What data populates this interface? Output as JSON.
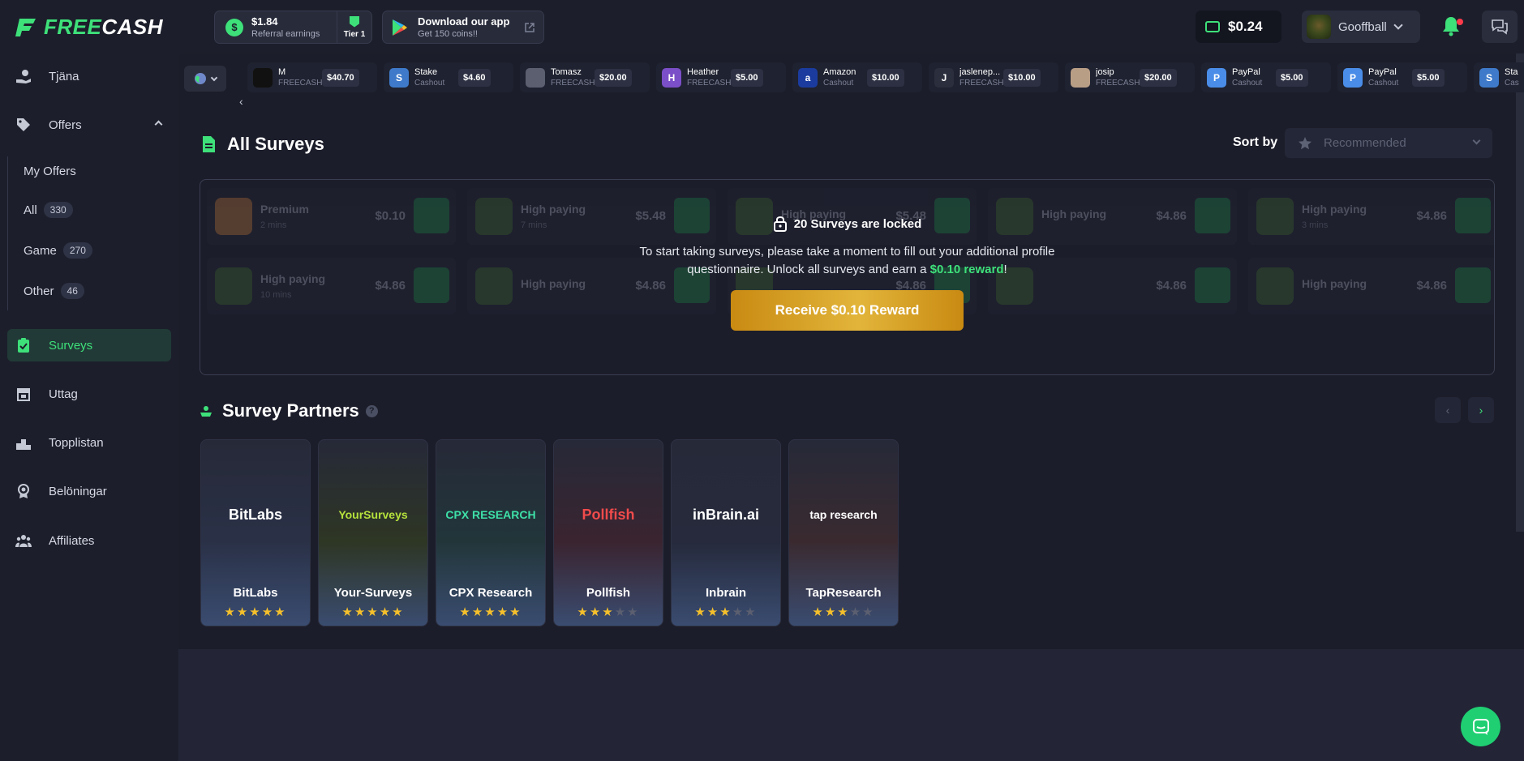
{
  "header": {
    "logo_text_1": "FREE",
    "logo_text_2": "CASH",
    "referral": {
      "amount": "$1.84",
      "label": "Referral earnings",
      "tier": "Tier 1"
    },
    "app_promo": {
      "title": "Download our app",
      "subtitle": "Get 150 coins!!"
    },
    "balance": "$0.24",
    "username": "Gooffball"
  },
  "sidebar": {
    "items": [
      {
        "label": "Tjäna"
      },
      {
        "label": "Offers"
      },
      {
        "label": "Surveys"
      },
      {
        "label": "Uttag"
      },
      {
        "label": "Topplistan"
      },
      {
        "label": "Belöningar"
      },
      {
        "label": "Affiliates"
      }
    ],
    "offers_sub": [
      {
        "label": "My Offers"
      },
      {
        "label": "All",
        "count": "330"
      },
      {
        "label": "Game",
        "count": "270"
      },
      {
        "label": "Other",
        "count": "46"
      }
    ]
  },
  "ticker": [
    {
      "name": "M",
      "source": "FREECASH",
      "amount": "$40.70",
      "color": "#111111",
      "glyph": ""
    },
    {
      "name": "Stake",
      "source": "Cashout",
      "amount": "$4.60",
      "color": "#3e7ac9",
      "glyph": "S"
    },
    {
      "name": "Tomasz",
      "source": "FREECASH",
      "amount": "$20.00",
      "color": "#5b5f70",
      "glyph": ""
    },
    {
      "name": "Heather",
      "source": "FREECASH",
      "amount": "$5.00",
      "color": "#7b4fc7",
      "glyph": "H"
    },
    {
      "name": "Amazon",
      "source": "Cashout",
      "amount": "$10.00",
      "color": "#1b3c9e",
      "glyph": "a"
    },
    {
      "name": "jaslenep...",
      "source": "FREECASH",
      "amount": "$10.00",
      "color": "#2b2f3d",
      "glyph": "J"
    },
    {
      "name": "josip",
      "source": "FREECASH",
      "amount": "$20.00",
      "color": "#b99e86",
      "glyph": ""
    },
    {
      "name": "PayPal",
      "source": "Cashout",
      "amount": "$5.00",
      "color": "#4a8de8",
      "glyph": "P"
    },
    {
      "name": "PayPal",
      "source": "Cashout",
      "amount": "$5.00",
      "color": "#4a8de8",
      "glyph": "P"
    },
    {
      "name": "Sta",
      "source": "Cas",
      "amount": "",
      "color": "#3e7ac9",
      "glyph": "S"
    }
  ],
  "surveys": {
    "title": "All Surveys",
    "sort_label": "Sort by",
    "sort_value": "Recommended",
    "grid": [
      {
        "name": "Premium",
        "time": "2 mins",
        "amount": "$0.10",
        "premium": true
      },
      {
        "name": "High paying",
        "time": "7 mins",
        "amount": "$5.48"
      },
      {
        "name": "High paying",
        "time": "",
        "amount": "$5.48"
      },
      {
        "name": "High paying",
        "time": "",
        "amount": "$4.86"
      },
      {
        "name": "High paying",
        "time": "3 mins",
        "amount": "$4.86"
      },
      {
        "name": "High paying",
        "time": "10 mins",
        "amount": "$4.86"
      },
      {
        "name": "High paying",
        "time": "",
        "amount": "$4.86"
      },
      {
        "name": "",
        "time": "",
        "amount": "$4.86"
      },
      {
        "name": "",
        "time": "",
        "amount": "$4.86"
      },
      {
        "name": "High paying",
        "time": "",
        "amount": "$4.86"
      }
    ],
    "locked_title": "20 Surveys are locked",
    "locked_msg_1": "To start taking surveys, please take a moment to fill out your additional profile questionnaire. Unlock all surveys and earn a ",
    "locked_msg_highlight": "$0.10 reward",
    "locked_msg_2": "!",
    "reward_button": "Receive $0.10 Reward"
  },
  "partners": {
    "title": "Survey Partners",
    "help": "?",
    "list": [
      {
        "name": "BitLabs",
        "logo": "BitLabs",
        "stars": 5,
        "bg": "#2a3147",
        "logo_color": "#ffffff"
      },
      {
        "name": "Your-Surveys",
        "logo": "YourSurveys",
        "stars": 5,
        "bg": "#2e3624",
        "logo_color": "#b6e23c"
      },
      {
        "name": "CPX Research",
        "logo": "CPX RESEARCH",
        "stars": 5,
        "bg": "#22363a",
        "logo_color": "#3ee0a8"
      },
      {
        "name": "Pollfish",
        "logo": "Pollfish",
        "stars": 3,
        "bg": "#3a2430",
        "logo_color": "#f04b4b"
      },
      {
        "name": "Inbrain",
        "logo": "inBrain.ai",
        "stars": 3,
        "bg": "#262a3c",
        "logo_color": "#ffffff"
      },
      {
        "name": "TapResearch",
        "logo": "tap research",
        "stars": 3,
        "bg": "#3a2a30",
        "logo_color": "#ffffff"
      }
    ]
  },
  "colors": {
    "accent": "#3ee07a",
    "gold": "#e2b53a",
    "star": "#f5c02b"
  }
}
